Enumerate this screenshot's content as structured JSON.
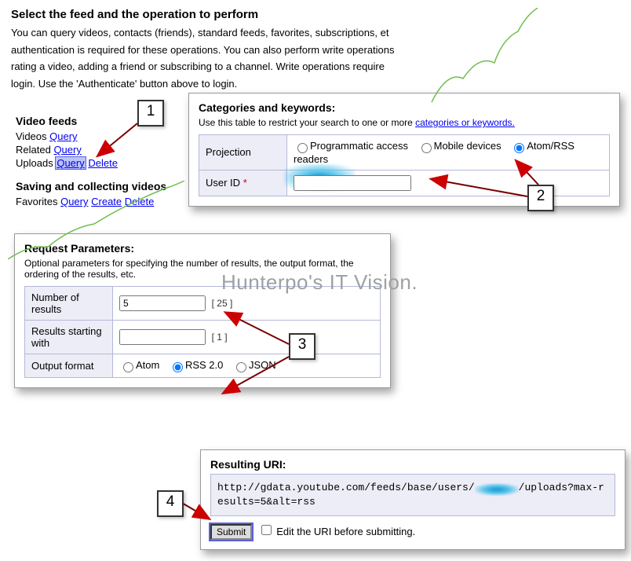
{
  "intro": {
    "heading": "Select the feed and the operation to perform",
    "line1": "You can query videos, contacts (friends), standard feeds, favorites, subscriptions, et",
    "line2": "authentication is required for these operations. You can also perform write operations",
    "line3": "rating a video, adding a friend or subscribing to a channel. Write operations require",
    "line4": "login. Use the 'Authenticate' button above to login."
  },
  "left": {
    "videoFeedsTitle": "Video feeds",
    "videos": "Videos",
    "related": "Related",
    "uploads": "Uploads",
    "savingTitle": "Saving and collecting videos",
    "favorites": "Favorites",
    "query": "Query",
    "create": "Create",
    "delete": "Delete"
  },
  "catPanel": {
    "title": "Categories and keywords:",
    "sub1": "Use this table to restrict your search to one or more ",
    "subLink": "categories or keywords.",
    "projLabel": "Projection",
    "proj1": "Programmatic access",
    "proj2": "Mobile devices",
    "proj3": "Atom/RSS readers",
    "userLabel": "User ID"
  },
  "reqPanel": {
    "title": "Request Parameters:",
    "sub": "Optional parameters for specifying the number of results, the output format, the ordering of the results, etc.",
    "numLabel": "Number of results",
    "numVal": "5",
    "numDef": "[ 25 ]",
    "startLabel": "Results starting with",
    "startVal": "",
    "startDef": "[ 1 ]",
    "outLabel": "Output format",
    "out1": "Atom",
    "out2": "RSS 2.0",
    "out3": "JSON"
  },
  "uriPanel": {
    "title": "Resulting URI:",
    "pre": "http://gdata.youtube.com/feeds/base/users/",
    "post": "/uploads?max-results=5&alt=rss",
    "submit": "Submit",
    "editLabel": "Edit the URI before submitting."
  },
  "watermark": "Hunterpo's IT Vision.",
  "callouts": {
    "c1": "1",
    "c2": "2",
    "c3": "3",
    "c4": "4"
  }
}
